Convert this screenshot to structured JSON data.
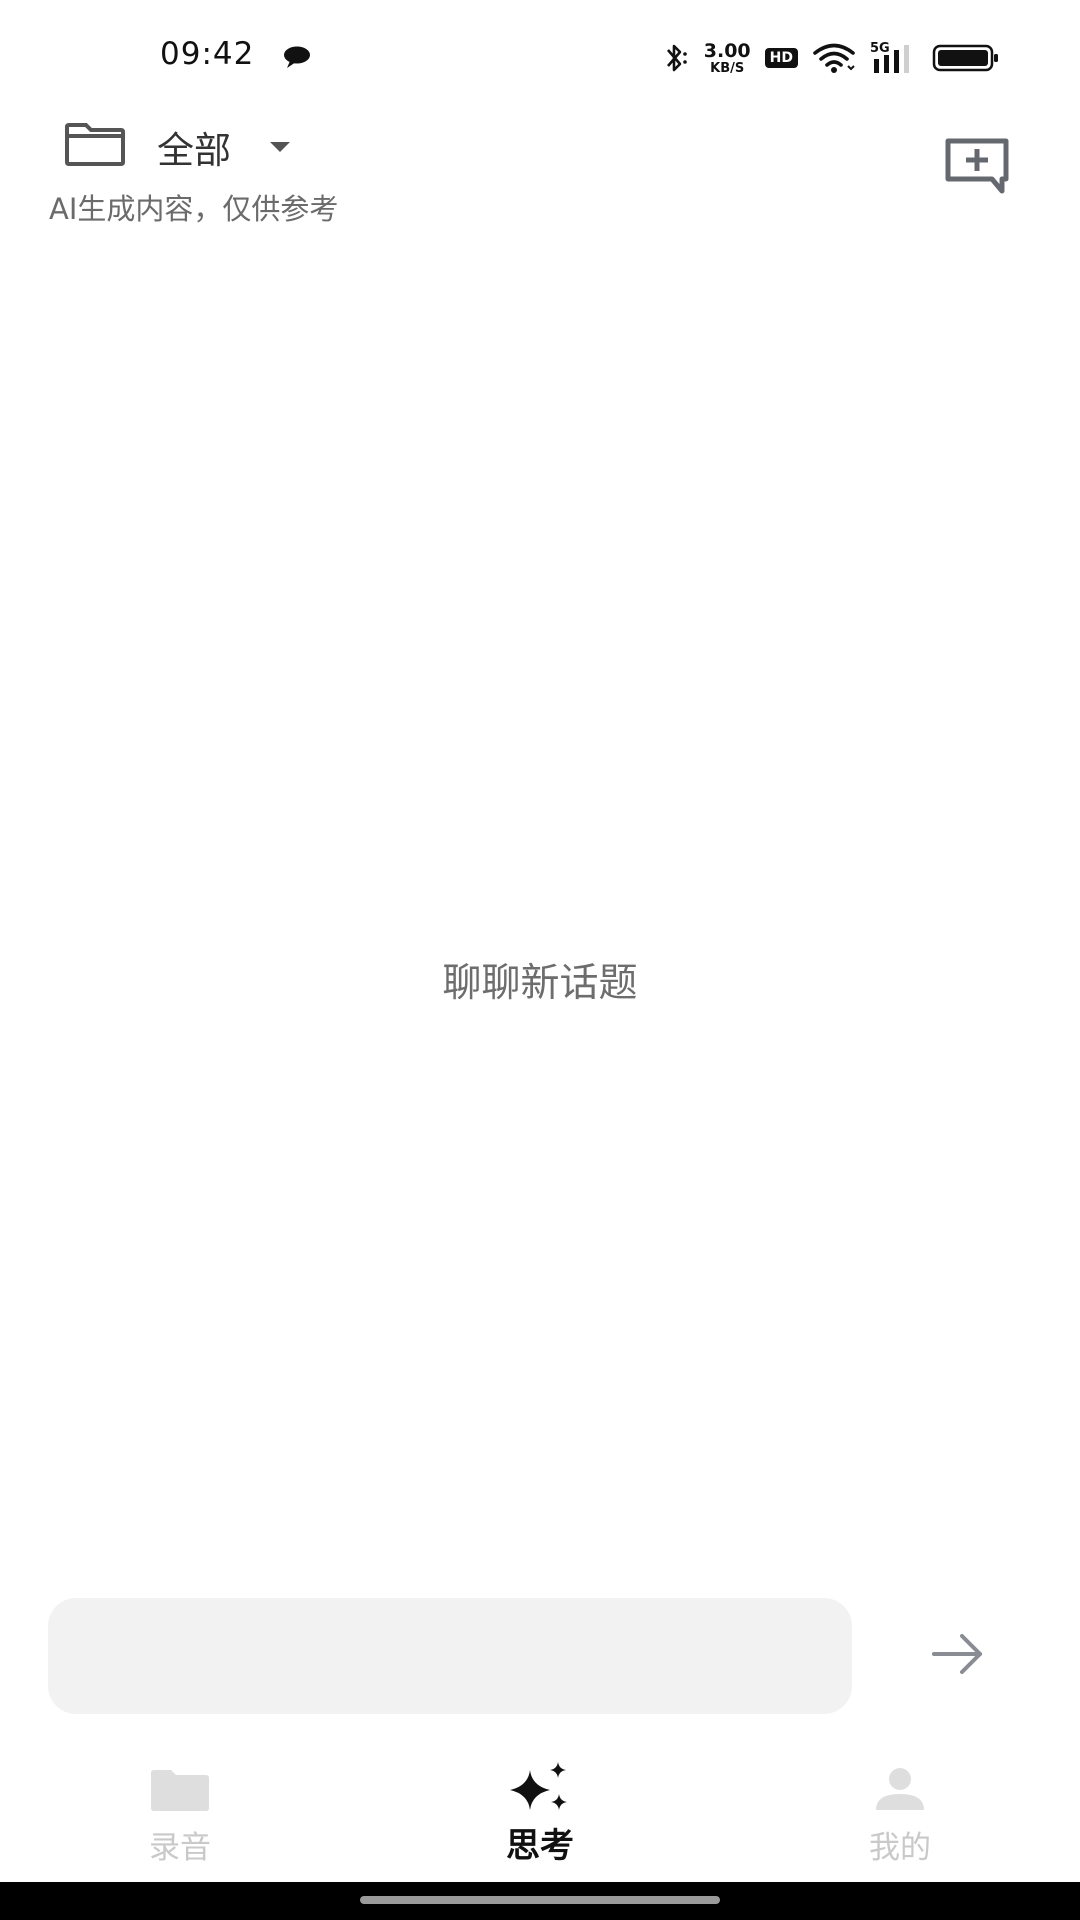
{
  "status_bar": {
    "time": "09:42",
    "net_speed_value": "3.00",
    "net_speed_unit": "KB/S",
    "hd_label": "HD",
    "network_type": "5G",
    "icons": [
      "message-bubble-icon",
      "bluetooth-icon",
      "wifi-icon",
      "signal-icon",
      "battery-icon"
    ]
  },
  "header": {
    "filter_label": "全部",
    "disclaimer": "AI生成内容，仅供参考",
    "icons": [
      "folder-icon",
      "caret-down-icon",
      "new-chat-icon"
    ]
  },
  "main": {
    "empty_prompt": "聊聊新话题"
  },
  "input": {
    "value": "",
    "placeholder": ""
  },
  "bottom_nav": {
    "items": [
      {
        "label": "录音",
        "icon": "folder-icon",
        "active": false
      },
      {
        "label": "思考",
        "icon": "sparkle-icon",
        "active": true
      },
      {
        "label": "我的",
        "icon": "person-icon",
        "active": false
      }
    ]
  },
  "colors": {
    "active": "#111111",
    "inactive": "#c9c9c9",
    "input_bg": "#f2f2f3",
    "muted_text": "#6d6d6d",
    "icon_gray": "#666870"
  }
}
